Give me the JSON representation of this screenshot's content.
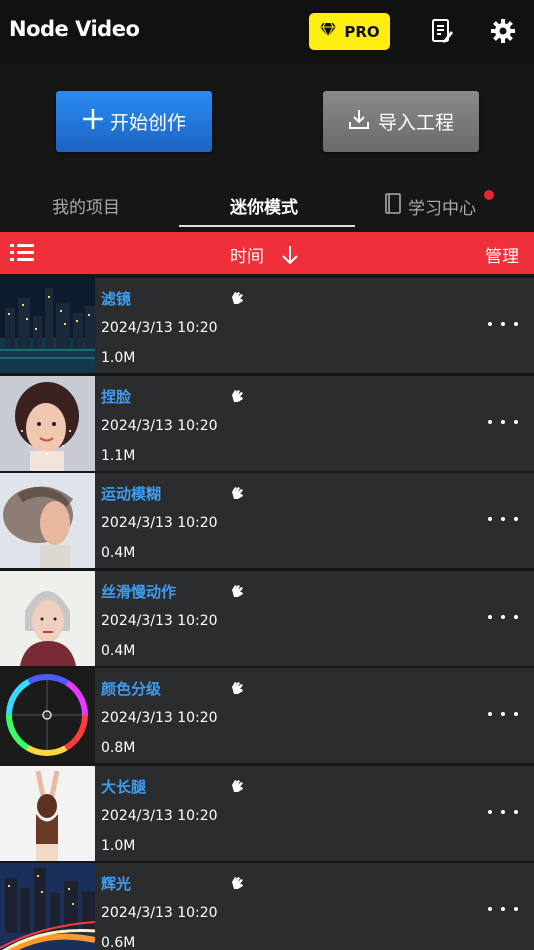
{
  "header": {
    "title": "Node Video",
    "pro_label": "PRO",
    "icons": [
      "diamond-icon",
      "document-edit-icon",
      "gear-icon"
    ]
  },
  "actions": {
    "create_label": "开始创作",
    "import_label": "导入工程"
  },
  "tabs": [
    {
      "label": "我的项目",
      "active": false
    },
    {
      "label": "迷你模式",
      "active": true
    },
    {
      "label": "学习中心",
      "active": false,
      "has_notification": true
    }
  ],
  "sortbar": {
    "sort_label": "时间",
    "sort_direction": "down",
    "manage_label": "管理"
  },
  "colors": {
    "accent_blue": "#3f9cf1",
    "sort_bar_red": "#ef3038",
    "pro_yellow": "#ffee10"
  },
  "items": [
    {
      "name": "滤镜",
      "date": "2024/3/13 10:20",
      "size": "1.0M",
      "thumb": "city-night"
    },
    {
      "name": "捏脸",
      "date": "2024/3/13 10:20",
      "size": "1.1M",
      "thumb": "face-portrait"
    },
    {
      "name": "运动模糊",
      "date": "2024/3/13 10:20",
      "size": "0.4M",
      "thumb": "hair-motion"
    },
    {
      "name": "丝滑慢动作",
      "date": "2024/3/13 10:20",
      "size": "0.4M",
      "thumb": "woman-portrait"
    },
    {
      "name": "颜色分级",
      "date": "2024/3/13 10:20",
      "size": "0.8M",
      "thumb": "color-wheel"
    },
    {
      "name": "大长腿",
      "date": "2024/3/13 10:20",
      "size": "1.0M",
      "thumb": "stretch-pose"
    },
    {
      "name": "辉光",
      "date": "2024/3/13 10:20",
      "size": "0.6M",
      "thumb": "city-lights"
    }
  ]
}
